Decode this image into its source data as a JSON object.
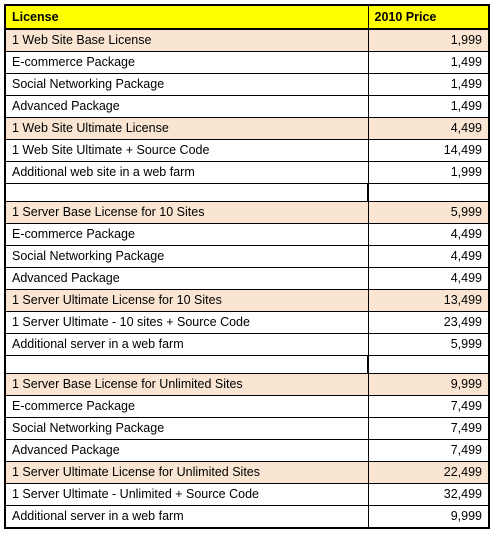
{
  "table": {
    "headers": {
      "license": "License",
      "price": "2010 Price"
    },
    "colors": {
      "header_background": "#FFFF00",
      "highlight_row_background": "#FAE5D3",
      "normal_row_background": "#FFFFFF",
      "border": "#000000",
      "text": "#000000"
    },
    "rows": [
      {
        "license": "1 Web Site Base License",
        "price": "1,999",
        "style": "highlight"
      },
      {
        "license": "E-commerce Package",
        "price": "1,499",
        "style": "normal"
      },
      {
        "license": "Social Networking Package",
        "price": "1,499",
        "style": "normal"
      },
      {
        "license": "Advanced Package",
        "price": "1,499",
        "style": "normal"
      },
      {
        "license": "1 Web Site Ultimate License",
        "price": "4,499",
        "style": "highlight"
      },
      {
        "license": "1 Web Site Ultimate + Source Code",
        "price": "14,499",
        "style": "normal"
      },
      {
        "license": "Additional web site in a web farm",
        "price": "1,999",
        "style": "normal"
      },
      {
        "license": "",
        "price": "",
        "style": "spacer"
      },
      {
        "license": "1 Server Base License for 10 Sites",
        "price": "5,999",
        "style": "highlight"
      },
      {
        "license": "E-commerce Package",
        "price": "4,499",
        "style": "normal"
      },
      {
        "license": "Social Networking Package",
        "price": "4,499",
        "style": "normal"
      },
      {
        "license": "Advanced Package",
        "price": "4,499",
        "style": "normal"
      },
      {
        "license": "1 Server Ultimate License for 10 Sites",
        "price": "13,499",
        "style": "highlight"
      },
      {
        "license": "1 Server Ultimate - 10 sites + Source Code",
        "price": "23,499",
        "style": "normal"
      },
      {
        "license": "Additional server in a web farm",
        "price": "5,999",
        "style": "normal"
      },
      {
        "license": "",
        "price": "",
        "style": "spacer"
      },
      {
        "license": "1 Server Base License for Unlimited Sites",
        "price": "9,999",
        "style": "highlight"
      },
      {
        "license": "E-commerce Package",
        "price": "7,499",
        "style": "normal"
      },
      {
        "license": "Social Networking Package",
        "price": "7,499",
        "style": "normal"
      },
      {
        "license": "Advanced Package",
        "price": "7,499",
        "style": "normal"
      },
      {
        "license": "1 Server Ultimate License for Unlimited Sites",
        "price": "22,499",
        "style": "highlight"
      },
      {
        "license": "1 Server Ultimate - Unlimited + Source Code",
        "price": "32,499",
        "style": "normal"
      },
      {
        "license": "Additional server in a web farm",
        "price": "9,999",
        "style": "normal"
      }
    ]
  }
}
